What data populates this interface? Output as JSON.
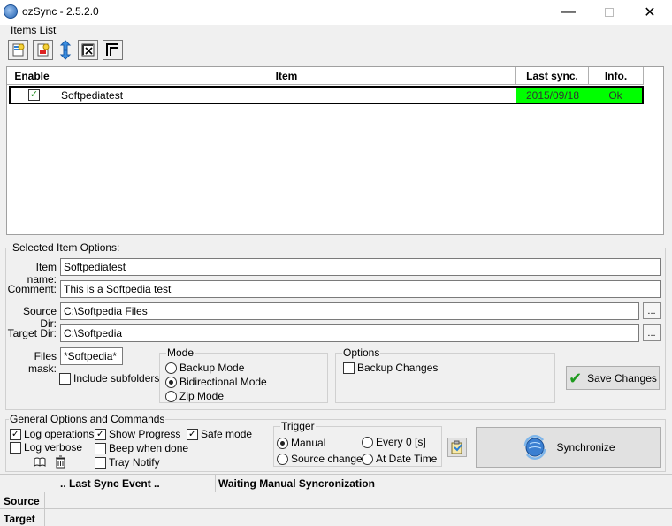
{
  "window": {
    "title": "ozSync - 2.5.2.0",
    "min_icon": "minimize-icon",
    "max_icon": "maximize-icon",
    "close_icon": "close-icon"
  },
  "items_list": {
    "label": "Items List",
    "toolbar": [
      {
        "name": "add-item-icon"
      },
      {
        "name": "delete-item-icon"
      },
      {
        "name": "sync-arrows-icon"
      },
      {
        "name": "disable-item-icon"
      },
      {
        "name": "corner-frame-icon"
      }
    ],
    "columns": {
      "enable": "Enable",
      "item": "Item",
      "last_sync": "Last sync.",
      "info": "Info."
    },
    "rows": [
      {
        "enabled": true,
        "item": "Softpediatest",
        "last_sync": "2015/09/18",
        "info": "Ok",
        "status_color": "#00ff00"
      }
    ]
  },
  "selected_options": {
    "label": "Selected Item Options:",
    "item_name_label": "Item name:",
    "item_name": "Softpediatest",
    "comment_label": "Comment:",
    "comment": "This is a Softpedia test",
    "source_dir_label": "Source Dir:",
    "source_dir": "C:\\Softpedia Files",
    "target_dir_label": "Target Dir:",
    "target_dir": "C:\\Softpedia",
    "browse_label": "...",
    "files_mask_label": "Files mask:",
    "files_mask": "*Softpedia*",
    "include_subfolders": "Include subfolders",
    "mode": {
      "label": "Mode",
      "options": [
        "Backup Mode",
        "Bidirectional Mode",
        "Zip Mode"
      ],
      "selected": "Bidirectional Mode"
    },
    "options": {
      "label": "Options",
      "backup_changes": "Backup Changes"
    },
    "save_changes": "Save Changes"
  },
  "general": {
    "label": "General Options and Commands",
    "log_operations": "Log operations",
    "log_verbose": "Log verbose",
    "show_progress": "Show Progress",
    "beep_when_done": "Beep when done",
    "tray_notify": "Tray Notify",
    "safe_mode": "Safe mode",
    "trigger": {
      "label": "Trigger",
      "manual": "Manual",
      "source_change": "Source change",
      "every": "Every 0 [s]",
      "at_date_time": "At Date Time",
      "selected": "Manual"
    },
    "synchronize": "Synchronize"
  },
  "status": {
    "last_sync_event": ".. Last Sync Event ..",
    "state": "Waiting Manual Syncronization",
    "source_label": "Source",
    "target_label": "Target"
  }
}
